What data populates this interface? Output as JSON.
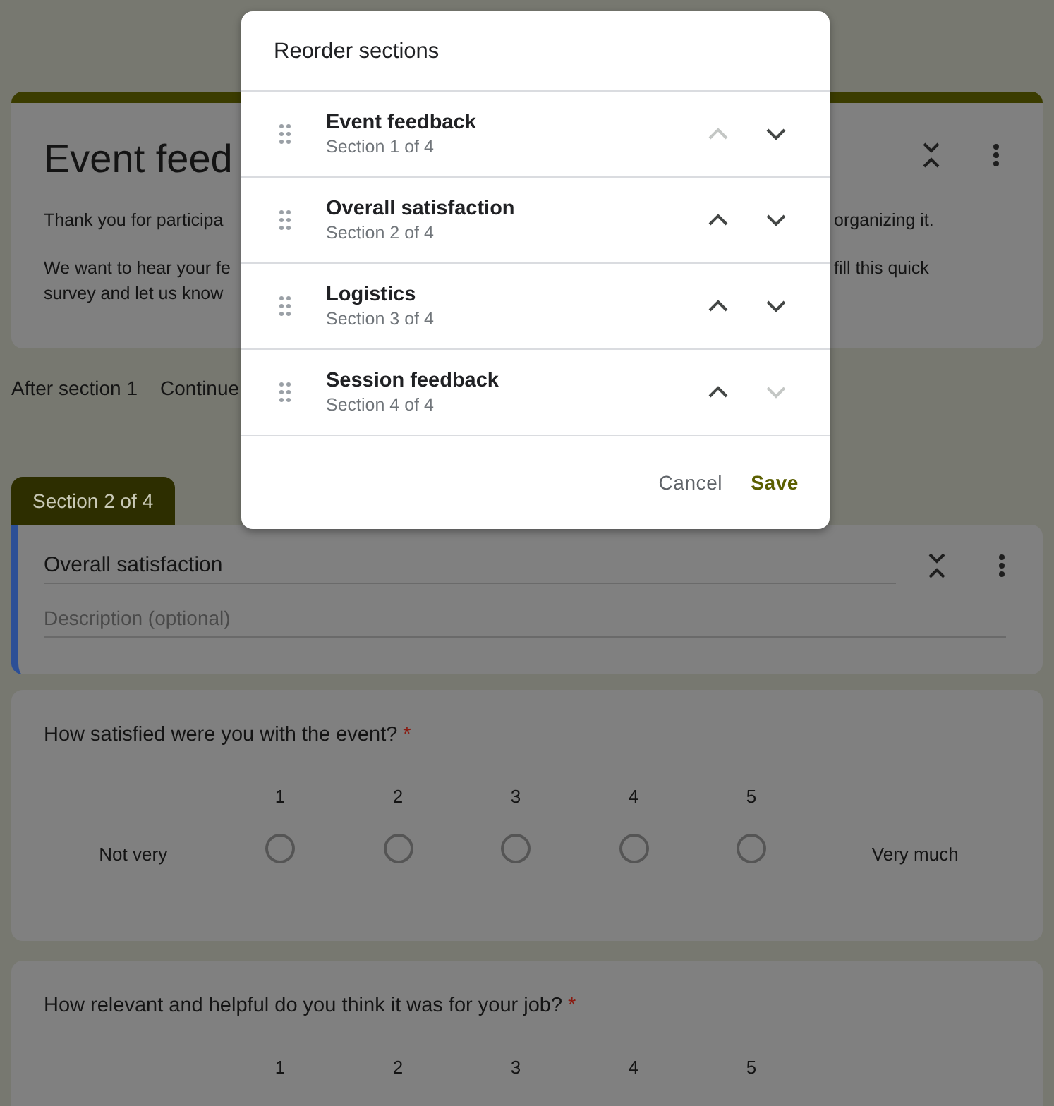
{
  "header_card": {
    "title": "Event feed",
    "description": [
      {
        "left": "Thank you for participa",
        "right": "organizing it."
      },
      {
        "left": "We want to hear your fe",
        "right": "fill this quick"
      },
      {
        "left": "survey and let us know"
      }
    ]
  },
  "after_section": {
    "label": "After section 1",
    "action": "Continue"
  },
  "section": {
    "tab": "Section 2 of 4",
    "title": "Overall satisfaction",
    "description_placeholder": "Description (optional)"
  },
  "questions": [
    {
      "text": "How satisfied were you with the event?",
      "required_mark": "*",
      "options": [
        {
          "label": "1",
          "selected": false
        },
        {
          "label": "2",
          "selected": false
        },
        {
          "label": "3",
          "selected": false
        },
        {
          "label": "4",
          "selected": false
        },
        {
          "label": "5",
          "selected": false
        }
      ],
      "low_label": "Not very",
      "high_label": "Very much"
    },
    {
      "text": "How relevant and helpful do you think it was for your job?",
      "required_mark": "*",
      "scale": [
        "1",
        "2",
        "3",
        "4",
        "5"
      ]
    }
  ],
  "dialog": {
    "title": "Reorder sections",
    "sections": [
      {
        "name": "Event feedback",
        "subtitle": "Section 1 of 4",
        "up_disabled": true,
        "down_disabled": false
      },
      {
        "name": "Overall satisfaction",
        "subtitle": "Section 2 of 4",
        "up_disabled": false,
        "down_disabled": false
      },
      {
        "name": "Logistics",
        "subtitle": "Section 3 of 4",
        "up_disabled": false,
        "down_disabled": false
      },
      {
        "name": "Session feedback",
        "subtitle": "Section 4 of 4",
        "up_disabled": false,
        "down_disabled": true
      }
    ],
    "buttons": [
      {
        "label": "Cancel",
        "kind": "cancel"
      },
      {
        "label": "Save",
        "kind": "save"
      }
    ]
  }
}
